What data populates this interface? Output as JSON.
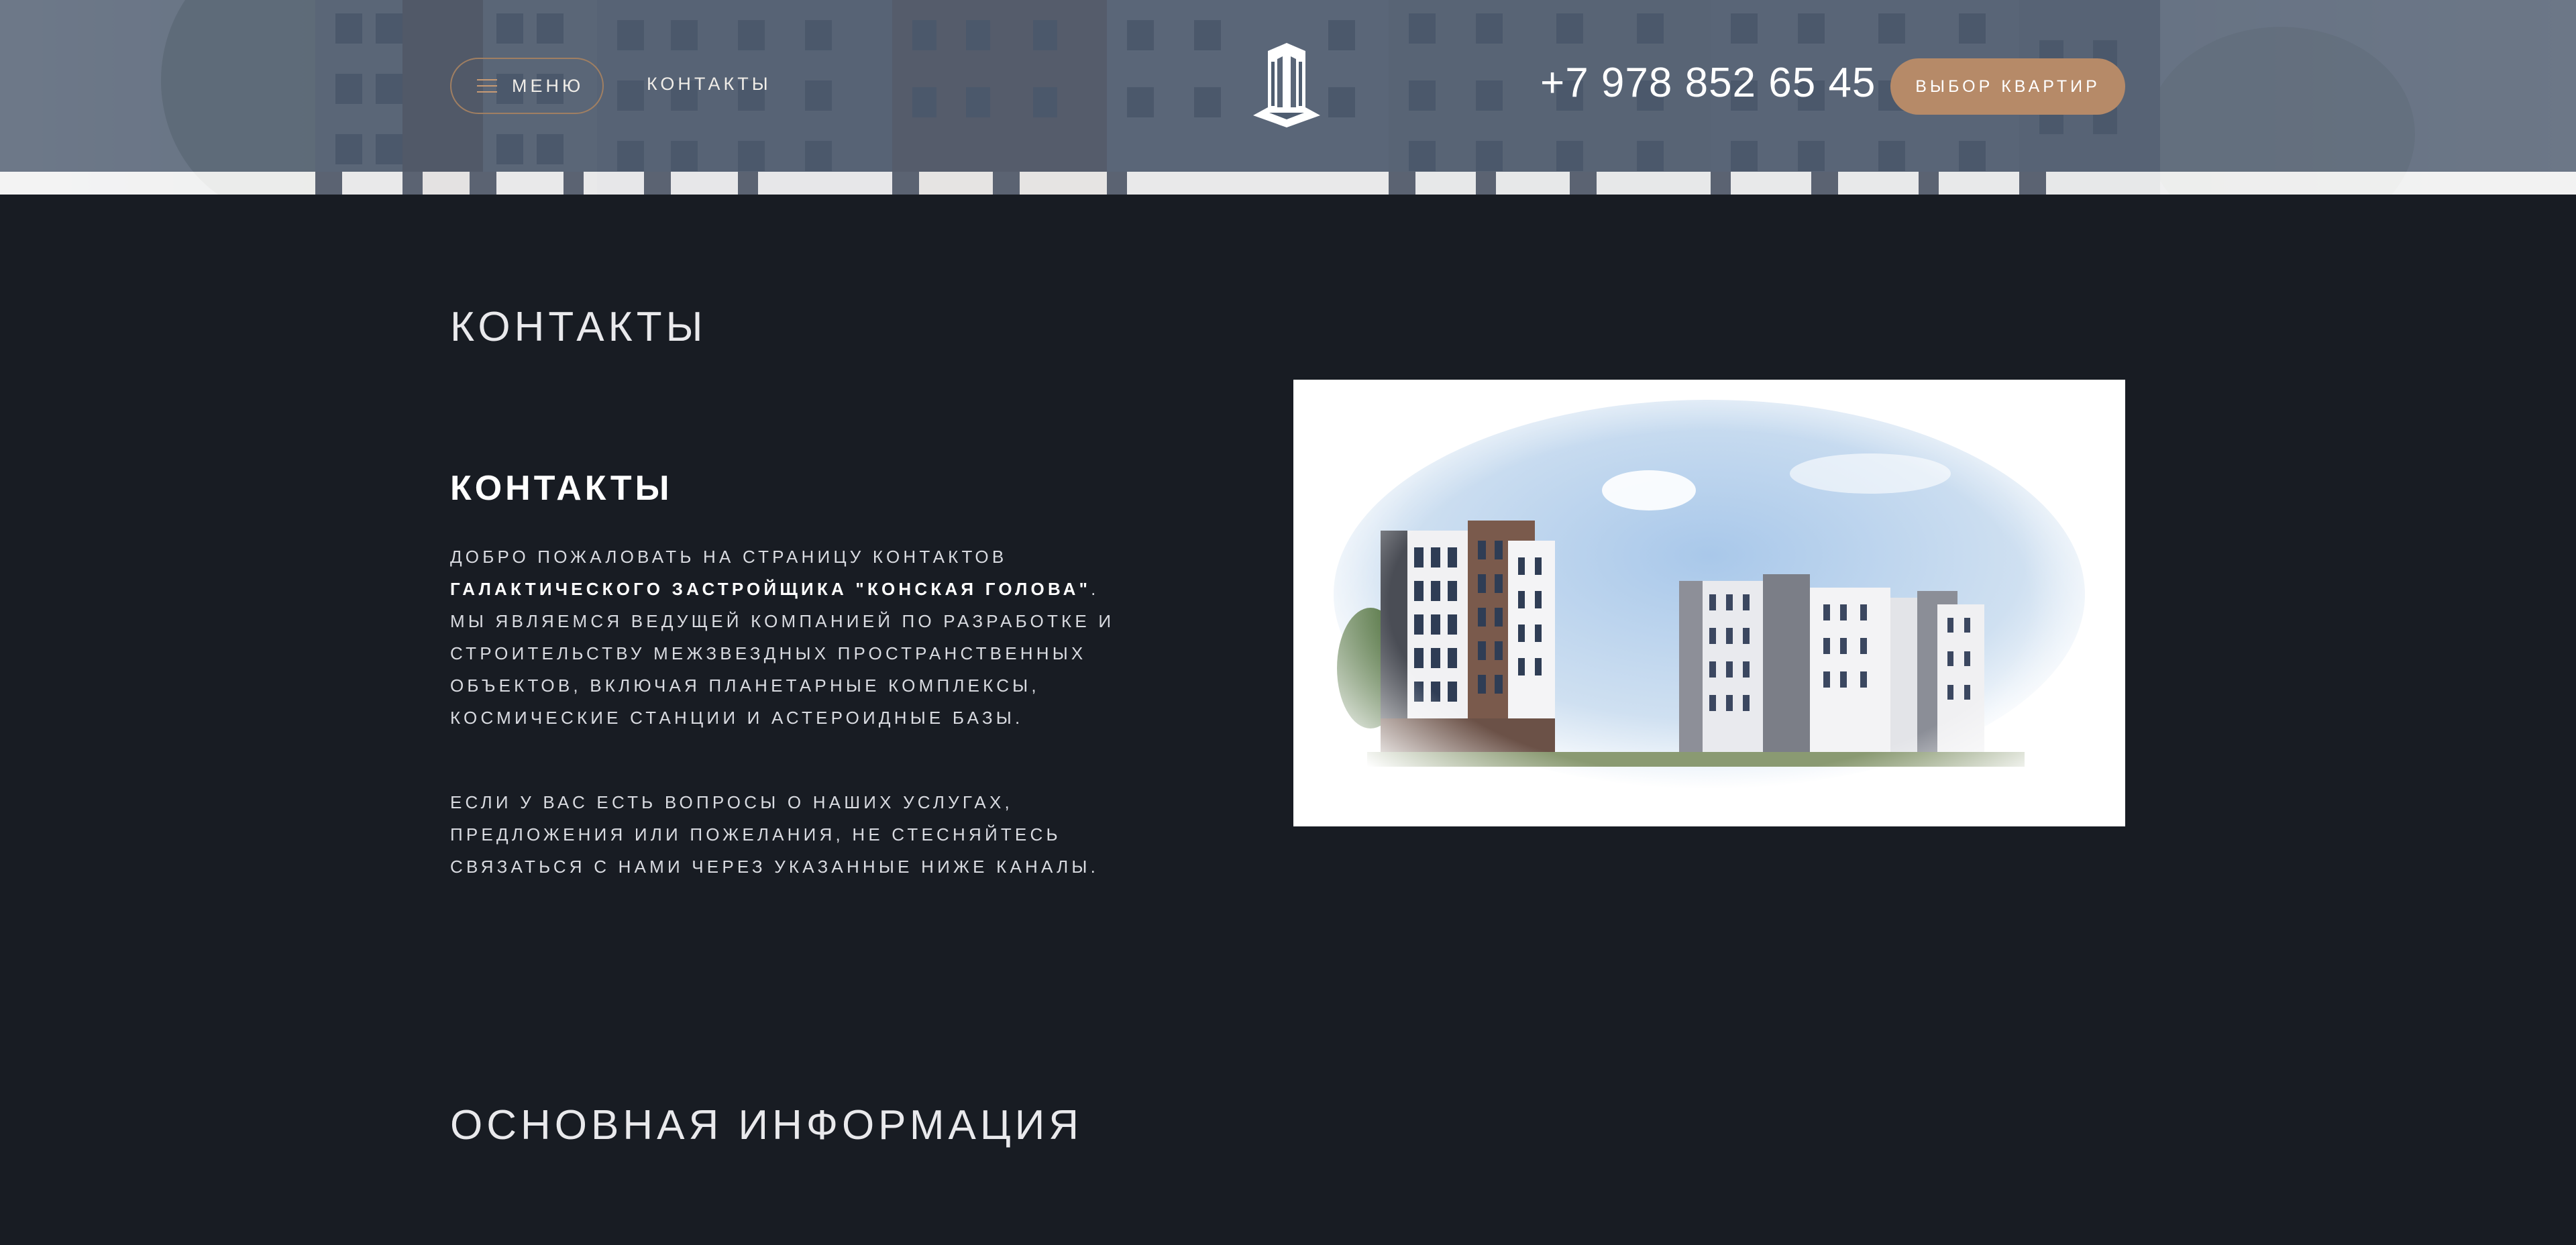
{
  "header": {
    "menu_label": "МЕНЮ",
    "contacts_link": "КОНТАКТЫ",
    "phone": "+7 978 852 65 45",
    "cta_label": "ВЫБОР КВАРТИР",
    "logo_icon": "building-logo-icon",
    "menu_icon": "hamburger-icon"
  },
  "main": {
    "page_title": "КОНТАКТЫ",
    "section_heading": "КОНТАКТЫ",
    "intro_lead": "ДОБРО ПОЖАЛОВАТЬ НА СТРАНИЦУ КОНТАКТОВ",
    "intro_company": "ГАЛАКТИЧЕСКОГО ЗАСТРОЙЩИКА \"КОНСКАЯ ГОЛОВА\"",
    "intro_rest": ". МЫ ЯВЛЯЕМСЯ ВЕДУЩЕЙ КОМПАНИЕЙ ПО РАЗРАБОТКЕ И СТРОИТЕЛЬСТВУ МЕЖЗВЕЗДНЫХ ПРОСТРАНСТВЕННЫХ ОБЪЕКТОВ, ВКЛЮЧАЯ ПЛАНЕТАРНЫЕ КОМПЛЕКСЫ, КОСМИЧЕСКИЕ СТАНЦИИ И АСТЕРОИДНЫЕ БАЗЫ.",
    "contact_note": "ЕСЛИ У ВАС ЕСТЬ ВОПРОСЫ О НАШИХ УСЛУГАХ, ПРЕДЛОЖЕНИЯ ИЛИ ПОЖЕЛАНИЯ, НЕ СТЕСНЯЙТЕСЬ СВЯЗАТЬСЯ С НАМИ ЧЕРЕЗ УКАЗАННЫЕ НИЖЕ КАНАЛЫ.",
    "bottom_title": "ОСНОВНАЯ ИНФОРМАЦИЯ"
  },
  "colors": {
    "page_bg": "#181c23",
    "header_overlay": "#4f5d70",
    "accent": "#b68a68",
    "text": "#d9dbe1"
  }
}
